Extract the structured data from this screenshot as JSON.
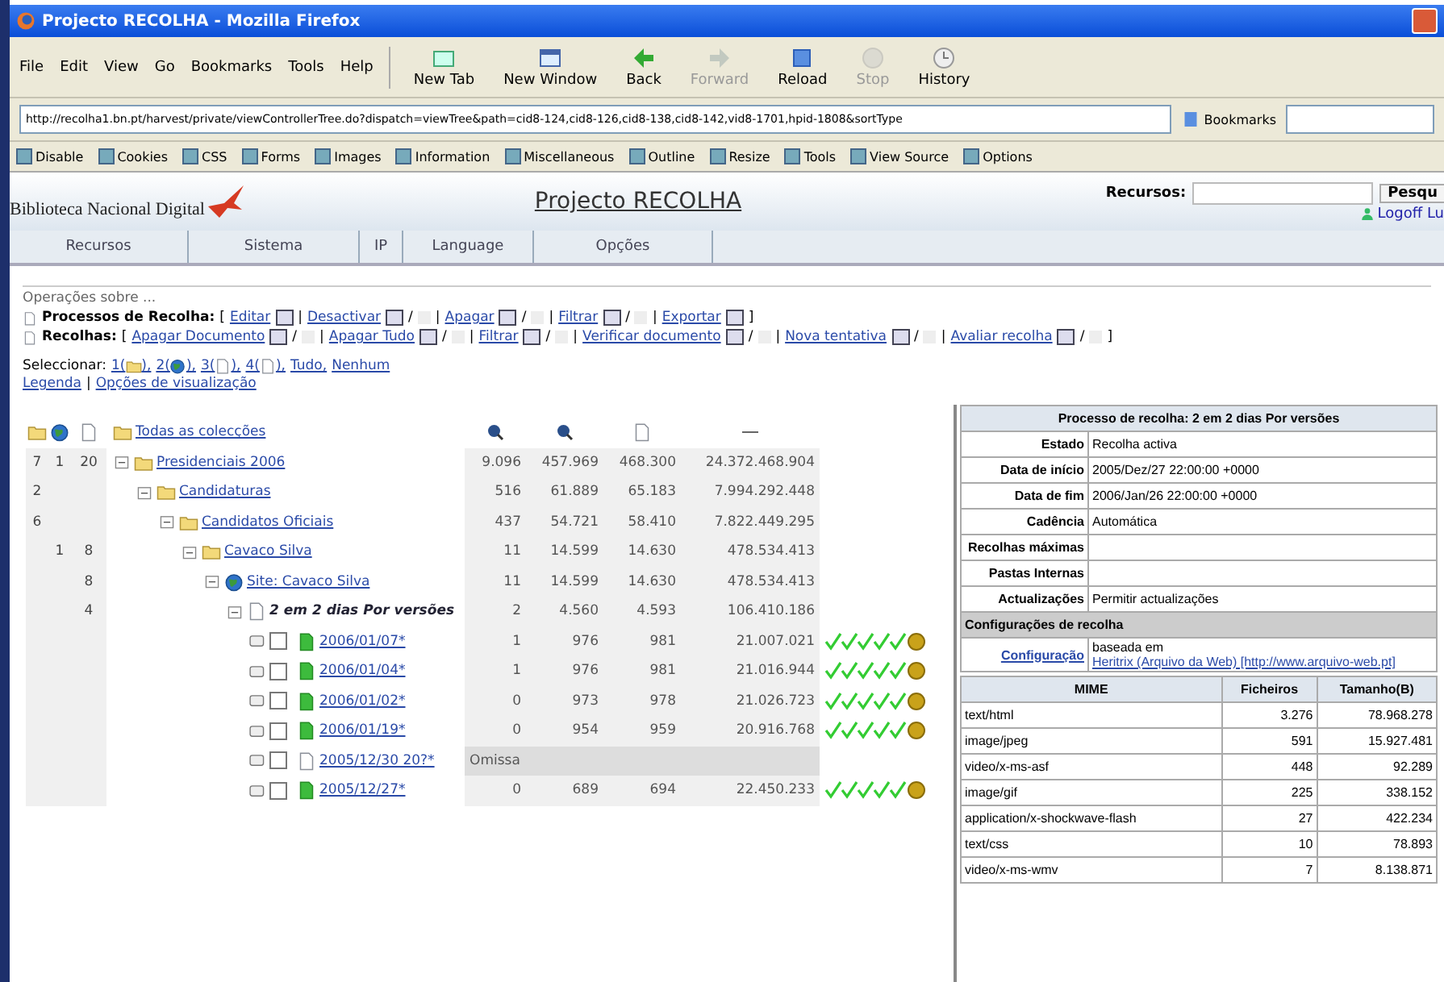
{
  "window": {
    "title": "Projecto RECOLHA - Mozilla Firefox"
  },
  "menu": [
    "File",
    "Edit",
    "View",
    "Go",
    "Bookmarks",
    "Tools",
    "Help"
  ],
  "toolbar": [
    {
      "label": "New Tab",
      "kind": "tab",
      "disabled": false
    },
    {
      "label": "New Window",
      "kind": "window",
      "disabled": false
    },
    {
      "label": "Back",
      "kind": "back",
      "disabled": false
    },
    {
      "label": "Forward",
      "kind": "forward",
      "disabled": true
    },
    {
      "label": "Reload",
      "kind": "reload",
      "disabled": false
    },
    {
      "label": "Stop",
      "kind": "stop",
      "disabled": true
    },
    {
      "label": "History",
      "kind": "history",
      "disabled": false
    }
  ],
  "address_bar": {
    "value": "http://recolha1.bn.pt/harvest/private/viewControllerTree.do?dispatch=viewTree&path=cid8-124,cid8-126,cid8-138,cid8-142,vid8-1701,hpid-1808&sortType"
  },
  "bookmarks_button": "Bookmarks",
  "webdev_toolbar": [
    "Disable",
    "Cookies",
    "CSS",
    "Forms",
    "Images",
    "Information",
    "Miscellaneous",
    "Outline",
    "Resize",
    "Tools",
    "View Source",
    "Options"
  ],
  "site_header": {
    "logo": "Biblioteca Nacional Digital",
    "title": "Projecto RECOLHA",
    "search_label": "Recursos:",
    "search_button": "Pesqu",
    "logoff": "Logoff Lu"
  },
  "nav_tabs": [
    "Recursos",
    "Sistema",
    "IP",
    "Language",
    "Opções"
  ],
  "operations": {
    "title": "Operações sobre ...",
    "groups": [
      {
        "label": "Processos de Recolha:",
        "open": "[",
        "close": "]",
        "separator": "|",
        "actions": [
          {
            "label": "Editar"
          },
          {
            "label": "Desactivar",
            "suffix": "/"
          },
          {
            "label": "Apagar",
            "suffix": "/"
          },
          {
            "label": "Filtrar",
            "suffix": "/"
          },
          {
            "label": "Exportar"
          }
        ]
      },
      {
        "label": "Recolhas:",
        "open": "[",
        "close": "]",
        "separator": "|",
        "actions": [
          {
            "label": "Apagar Documento",
            "suffix": "/"
          },
          {
            "label": "Apagar Tudo",
            "suffix": "/"
          },
          {
            "label": "Filtrar",
            "suffix": "/"
          },
          {
            "label": "Verificar documento",
            "suffix": "/"
          },
          {
            "label": "Nova tentativa",
            "suffix": "/"
          },
          {
            "label": "Avaliar recolha",
            "suffix": "/"
          }
        ]
      }
    ]
  },
  "select": {
    "label": "Seleccionar:",
    "items": [
      {
        "kind": "folder",
        "prefix": "1(",
        "suffix": "),"
      },
      {
        "kind": "site",
        "prefix": "2(",
        "suffix": "),"
      },
      {
        "kind": "page",
        "prefix": "3(",
        "suffix": "),"
      },
      {
        "kind": "page",
        "prefix": "4(",
        "suffix": "),"
      },
      {
        "kind": "text",
        "prefix": "Tudo,"
      },
      {
        "kind": "text",
        "prefix": "Nenhum"
      }
    ]
  },
  "links": {
    "separator": "|",
    "items": [
      "Legenda",
      "Opções de visualização"
    ]
  },
  "tree": {
    "label": "Todas as colecções",
    "children": [
      {
        "kind": "folder",
        "label": "Presidenciais 2006",
        "count_1": "7",
        "count_2": "1",
        "count_3": "20",
        "stats": [
          "9.096",
          "457.969",
          "468.300",
          "24.372.468.904"
        ],
        "children": [
          {
            "kind": "folder",
            "label": "Candidaturas",
            "count_1": "2",
            "stats": [
              "516",
              "61.889",
              "65.183",
              "7.994.292.448"
            ],
            "children": [
              {
                "kind": "folder",
                "label": "Candidatos Oficiais",
                "count_1": "6",
                "stats": [
                  "437",
                  "54.721",
                  "58.410",
                  "7.822.449.295"
                ],
                "children": [
                  {
                    "kind": "folder",
                    "label": "Cavaco Silva",
                    "count_2": "1",
                    "count_3": "8",
                    "stats": [
                      "11",
                      "14.599",
                      "14.630",
                      "478.534.413"
                    ],
                    "children": [
                      {
                        "kind": "site",
                        "label": "Site: Cavaco Silva",
                        "count_3": "8",
                        "stats": [
                          "11",
                          "14.599",
                          "14.630",
                          "478.534.413"
                        ],
                        "children": [
                          {
                            "kind": "process",
                            "label": "2 em 2 dias Por versões",
                            "count_3": "4",
                            "stats": [
                              "2",
                              "4.560",
                              "4.593",
                              "106.410.186"
                            ],
                            "children": [
                              {
                                "kind": "version",
                                "label": "2006/01/07*",
                                "checked": false,
                                "verified": true,
                                "stats": [
                                  "1",
                                  "976",
                                  "981",
                                  "21.007.021"
                                ]
                              },
                              {
                                "kind": "version",
                                "label": "2006/01/04*",
                                "checked": false,
                                "verified": true,
                                "stats": [
                                  "1",
                                  "976",
                                  "981",
                                  "21.016.944"
                                ]
                              },
                              {
                                "kind": "version",
                                "label": "2006/01/02*",
                                "checked": false,
                                "verified": true,
                                "stats": [
                                  "0",
                                  "973",
                                  "978",
                                  "21.026.723"
                                ]
                              },
                              {
                                "kind": "version",
                                "label": "2006/01/19*",
                                "checked": false,
                                "verified": true,
                                "stats": [
                                  "0",
                                  "954",
                                  "959",
                                  "20.916.768"
                                ]
                              },
                              {
                                "kind": "missing",
                                "label": "2005/12/30 20?*",
                                "checked": false,
                                "verified": false,
                                "note": "Omissa"
                              },
                              {
                                "kind": "version",
                                "label": "2005/12/27*",
                                "checked": false,
                                "verified": true,
                                "stats": [
                                  "0",
                                  "689",
                                  "694",
                                  "22.450.233"
                                ]
                              }
                            ]
                          }
                        ]
                      }
                    ]
                  }
                ]
              }
            ]
          }
        ]
      }
    ]
  },
  "detail": {
    "title": "Processo de recolha: 2 em 2 dias Por versões",
    "fields": [
      {
        "label": "Estado",
        "value": "Recolha activa"
      },
      {
        "label": "Data de início",
        "value": "2005/Dez/27 22:00:00 +0000"
      },
      {
        "label": "Data de fim",
        "value": "2006/Jan/26 22:00:00 +0000"
      },
      {
        "label": "Cadência",
        "value": "Automática"
      },
      {
        "label": "Recolhas máximas"
      },
      {
        "label": "Pastas Internas"
      },
      {
        "label": "Actualizações",
        "value": "Permitir actualizações"
      }
    ],
    "config_title": "Configurações de recolha",
    "config": {
      "label": "Configuração",
      "text": "baseada em",
      "link": "Heritrix (Arquivo da Web) [http://www.arquivo-web.pt]"
    },
    "columns": [
      "MIME",
      "Ficheiros",
      "Tamanho(B)"
    ],
    "rows": [
      [
        "text/html",
        "3.276",
        "78.968.278"
      ],
      [
        "image/jpeg",
        "591",
        "15.927.481"
      ],
      [
        "video/x-ms-asf",
        "448",
        "92.289"
      ],
      [
        "image/gif",
        "225",
        "338.152"
      ],
      [
        "application/x-shockwave-flash",
        "27",
        "422.234"
      ],
      [
        "text/css",
        "10",
        "78.893"
      ],
      [
        "video/x-ms-wmv",
        "7",
        "8.138.871"
      ]
    ]
  }
}
